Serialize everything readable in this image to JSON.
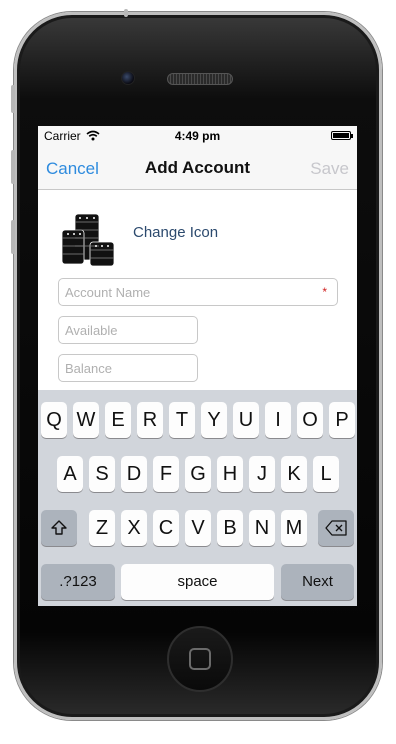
{
  "status_bar": {
    "carrier": "Carrier",
    "time": "4:49 pm"
  },
  "nav": {
    "cancel_label": "Cancel",
    "title": "Add Account",
    "save_label": "Save"
  },
  "form": {
    "change_icon_label": "Change Icon",
    "account_name": {
      "placeholder": "Account Name",
      "required_mark": "*"
    },
    "available": {
      "placeholder": "Available"
    },
    "balance": {
      "placeholder": "Balance"
    }
  },
  "keyboard": {
    "row1": [
      "Q",
      "W",
      "E",
      "R",
      "T",
      "Y",
      "U",
      "I",
      "O",
      "P"
    ],
    "row2": [
      "A",
      "S",
      "D",
      "F",
      "G",
      "H",
      "J",
      "K",
      "L"
    ],
    "row3": [
      "Z",
      "X",
      "C",
      "V",
      "B",
      "N",
      "M"
    ],
    "numbers_label": ".?123",
    "space_label": "space",
    "next_label": "Next"
  },
  "colors": {
    "accent": "#2e8bde",
    "link": "#2c4a6e",
    "disabled": "#c7c7cc",
    "keyboard_bg": "#d1d5db"
  },
  "icons": [
    "wifi-icon",
    "battery-icon",
    "coins-icon",
    "shift-icon",
    "backspace-icon",
    "home-button"
  ]
}
